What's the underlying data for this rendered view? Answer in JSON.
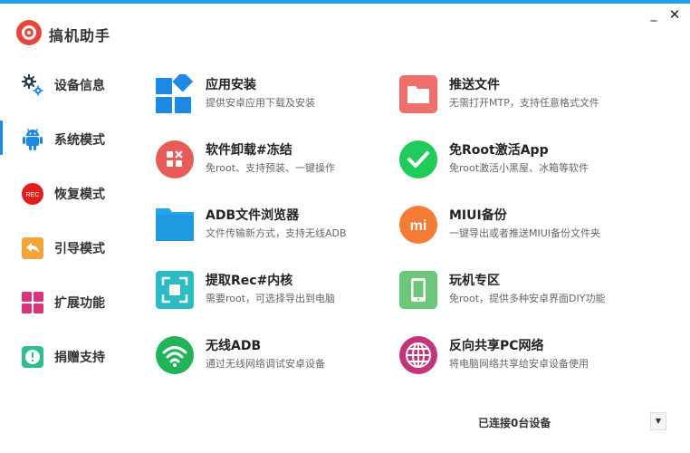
{
  "app": {
    "title": "搞机助手"
  },
  "window": {
    "minimize_label": "_",
    "close_label": "✕"
  },
  "colors": {
    "accent": "#1fa3e8",
    "indicator": "#1e88e5"
  },
  "sidebar": {
    "active_index": 1,
    "items": [
      {
        "label": "设备信息",
        "icon": "gears-icon"
      },
      {
        "label": "系统模式",
        "icon": "android-icon"
      },
      {
        "label": "恢复模式",
        "icon": "rec-icon",
        "icon_text": "REC"
      },
      {
        "label": "引导模式",
        "icon": "back-arrow-icon"
      },
      {
        "label": "扩展功能",
        "icon": "grid-icon"
      },
      {
        "label": "捐赠支持",
        "icon": "alert-icon"
      }
    ]
  },
  "features": {
    "left": [
      {
        "title": "应用安装",
        "desc": "提供安卓应用下载及安装",
        "icon": "apps-grid-icon"
      },
      {
        "title": "软件卸载#冻结",
        "desc": "免root、支持预装、一键操作",
        "icon": "uninstall-icon"
      },
      {
        "title": "ADB文件浏览器",
        "desc": "文件传输新方式，支持无线ADB",
        "icon": "folder-blue-icon"
      },
      {
        "title": "提取Rec#内核",
        "desc": "需要root，可选择导出到电脑",
        "icon": "scan-frame-icon"
      },
      {
        "title": "无线ADB",
        "desc": "通过无线网络调试安卓设备",
        "icon": "wifi-icon"
      }
    ],
    "right": [
      {
        "title": "推送文件",
        "desc": "无需打开MTP，支持任意格式文件",
        "icon": "folder-red-icon"
      },
      {
        "title": "免Root激活App",
        "desc": "免root激活小黑屋、冰箱等软件",
        "icon": "check-icon"
      },
      {
        "title": "MIUI备份",
        "desc": "一键导出或者推送MIUI备份文件夹",
        "icon": "mi-icon",
        "icon_text": "mi"
      },
      {
        "title": "玩机专区",
        "desc": "免root，提供多种安卓界面DIY功能",
        "icon": "phone-icon"
      },
      {
        "title": "反向共享PC网络",
        "desc": "将电脑网络共享给安卓设备使用",
        "icon": "globe-icon"
      }
    ]
  },
  "footer": {
    "status": "已连接0台设备",
    "dropdown_glyph": "▼"
  }
}
